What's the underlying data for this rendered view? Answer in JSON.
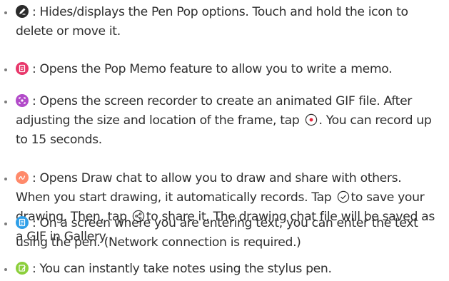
{
  "items": [
    {
      "icon": "pen-pop-icon",
      "icon_color": "#2b2b2b",
      "lines": [
        ": Hides/displays the Pen Pop options. Touch and hold the icon to",
        "delete or move it."
      ]
    },
    {
      "icon": "pop-memo-icon",
      "icon_color": "#e8386b",
      "lines": [
        ": Opens the Pop Memo feature to allow you to write a memo."
      ]
    },
    {
      "icon": "screen-recorder-icon",
      "icon_color": "#b24bc9",
      "lines": [
        ": Opens the screen recorder to create an animated GIF file. After",
        "adjusting the size and location of the frame, tap",
        ". You can record up",
        "to 15 seconds."
      ]
    },
    {
      "icon": "draw-chat-icon",
      "icon_color": "#ff8a6b",
      "lines": [
        ": Opens Draw chat to allow you to draw and share with others.",
        "When you start drawing, it automatically records. Tap",
        "to save your",
        "drawing. Then, tap",
        "to share it. The drawing chat file will be saved as",
        "a GIF in Gallery."
      ]
    },
    {
      "icon": "pen-keyboard-icon",
      "icon_color": "#2f9fe8",
      "lines": [
        ": On a screen where you are entering text, you can enter the text",
        "using the pen. (Network connection is required.)"
      ]
    },
    {
      "icon": "quick-notes-icon",
      "icon_color": "#8ccf3c",
      "lines": [
        ": You can instantly take notes using the stylus pen."
      ]
    }
  ],
  "bullet_color": "#7d7d7d",
  "text_color": "#2e2e2e"
}
